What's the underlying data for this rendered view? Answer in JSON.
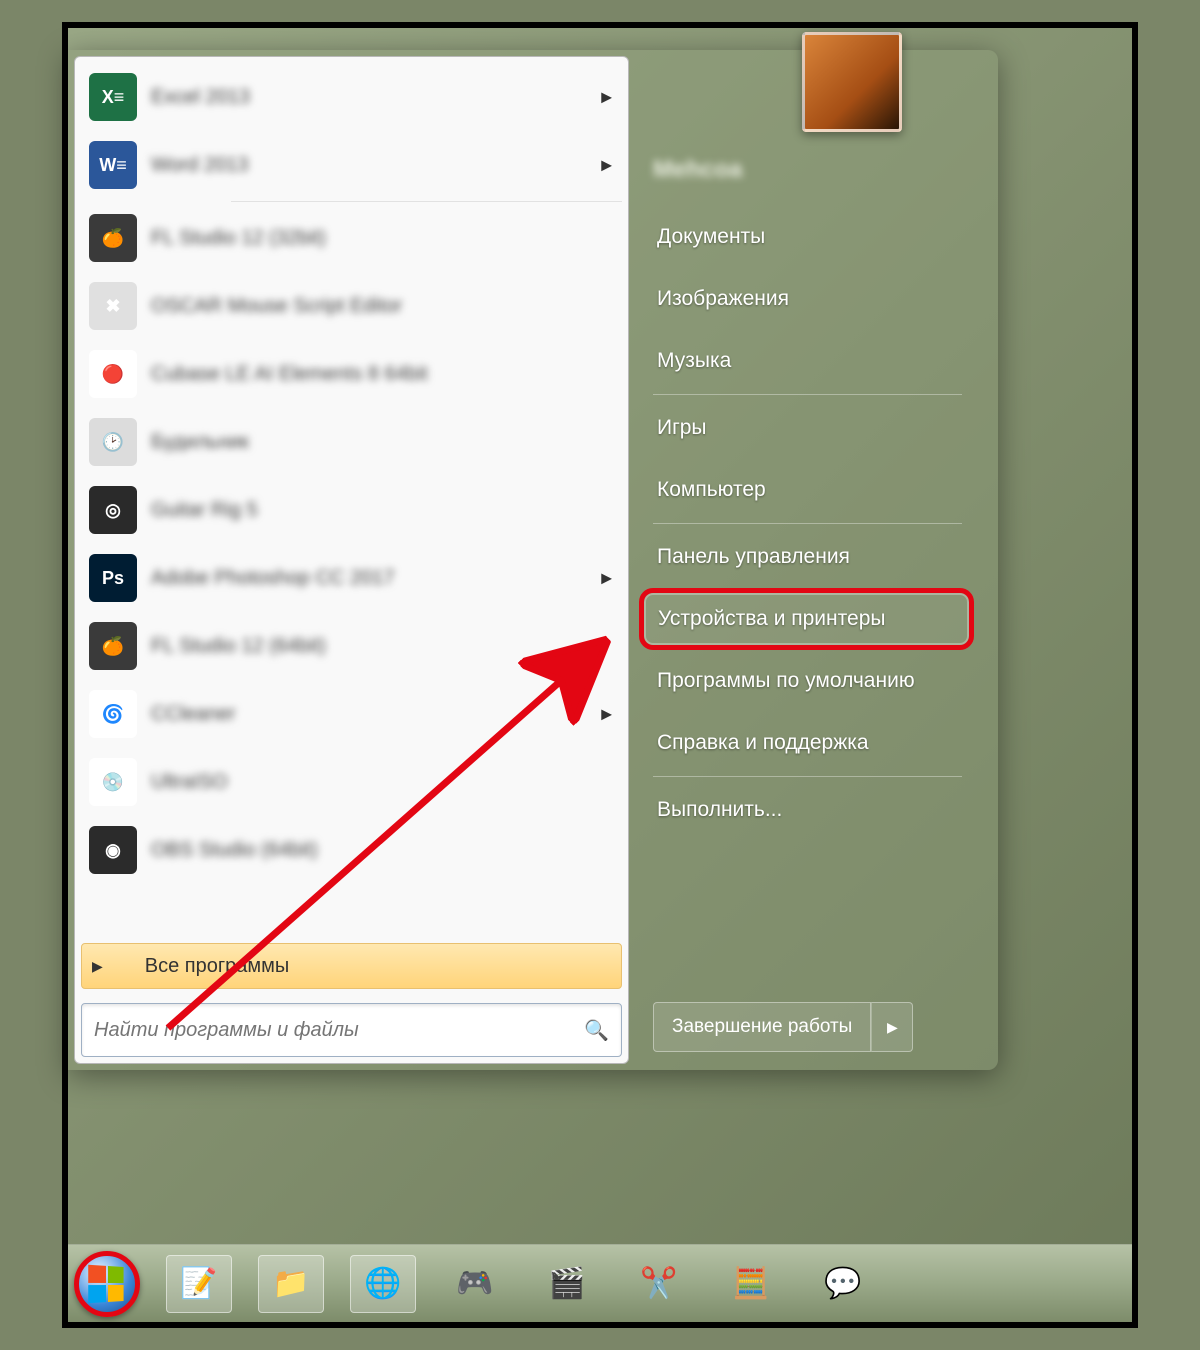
{
  "user": {
    "name": "Mehcoa"
  },
  "programs": [
    {
      "label": "Excel 2013",
      "has_submenu": true,
      "icon": "excel"
    },
    {
      "label": "Word 2013",
      "has_submenu": true,
      "icon": "word"
    },
    {
      "label": "FL Studio 12 (32bit)",
      "has_submenu": false,
      "icon": "flstudio"
    },
    {
      "label": "OSCAR Mouse Script Editor",
      "has_submenu": false,
      "icon": "oscar"
    },
    {
      "label": "Cubase LE AI Elements 8 64bit",
      "has_submenu": false,
      "icon": "cubase"
    },
    {
      "label": "Будильник",
      "has_submenu": false,
      "icon": "clock"
    },
    {
      "label": "Guitar Rig 5",
      "has_submenu": false,
      "icon": "guitarrig"
    },
    {
      "label": "Adobe Photoshop CC 2017",
      "has_submenu": true,
      "icon": "photoshop"
    },
    {
      "label": "FL Studio 12 (64bit)",
      "has_submenu": false,
      "icon": "flstudio"
    },
    {
      "label": "CCleaner",
      "has_submenu": true,
      "icon": "ccleaner"
    },
    {
      "label": "UltraISO",
      "has_submenu": false,
      "icon": "ultraiso"
    },
    {
      "label": "OBS Studio (64bit)",
      "has_submenu": false,
      "icon": "obs"
    }
  ],
  "all_programs_label": "Все программы",
  "search": {
    "placeholder": "Найти программы и файлы"
  },
  "right_items": {
    "documents": "Документы",
    "pictures": "Изображения",
    "music": "Музыка",
    "games": "Игры",
    "computer": "Компьютер",
    "control_panel": "Панель управления",
    "devices_printers": "Устройства и принтеры",
    "default_programs": "Программы по умолчанию",
    "help": "Справка и поддержка",
    "run": "Выполнить..."
  },
  "shutdown": {
    "label": "Завершение работы"
  },
  "taskbar_items": [
    {
      "name": "notepad",
      "glyph": "📝"
    },
    {
      "name": "explorer",
      "glyph": "📁"
    },
    {
      "name": "chrome",
      "glyph": "🌐"
    },
    {
      "name": "steam",
      "glyph": "🎮"
    },
    {
      "name": "mpc",
      "glyph": "🎬"
    },
    {
      "name": "snipping",
      "glyph": "✂️"
    },
    {
      "name": "calculator",
      "glyph": "🧮"
    },
    {
      "name": "discord",
      "glyph": "💬"
    }
  ],
  "icon_styles": {
    "excel": {
      "bg": "#1e7145",
      "txt": "X≡"
    },
    "word": {
      "bg": "#2b579a",
      "txt": "W≡"
    },
    "flstudio": {
      "bg": "#3a3a3a",
      "txt": "🍊"
    },
    "oscar": {
      "bg": "#e0e0e0",
      "txt": "✖"
    },
    "cubase": {
      "bg": "#ffffff",
      "txt": "🔴"
    },
    "clock": {
      "bg": "#dcdcdc",
      "txt": "🕑"
    },
    "guitarrig": {
      "bg": "#2a2a2a",
      "txt": "◎"
    },
    "photoshop": {
      "bg": "#001d33",
      "txt": "Ps"
    },
    "ccleaner": {
      "bg": "#ffffff",
      "txt": "🌀"
    },
    "ultraiso": {
      "bg": "#ffffff",
      "txt": "💿"
    },
    "obs": {
      "bg": "#2b2b2b",
      "txt": "◉"
    }
  }
}
